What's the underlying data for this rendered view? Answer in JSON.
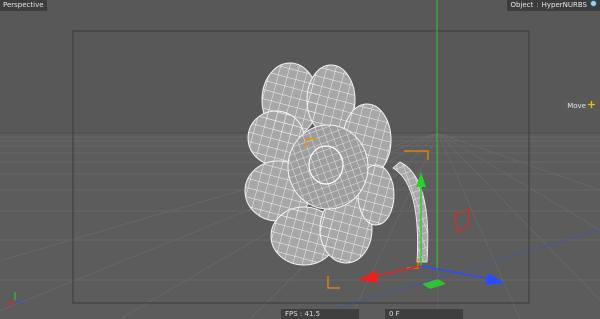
{
  "viewport": {
    "view_name": "Perspective",
    "object_label": "Object",
    "object_separator": ":",
    "object_name": "HyperNURBS",
    "move_label": "Move",
    "fps_label": "FPS",
    "fps_value": "41.5",
    "frame": "0 F",
    "object_icon": "hypernurbs-icon",
    "move_icon": "move-cross-icon",
    "axes_icon": "world-axes-icon"
  },
  "colors": {
    "background": "#5a5a5a",
    "grid": "#6a6a6a",
    "wireframe_fill": "#a9a9a9",
    "wireframe_line": "#f2f2f2",
    "axis_x": "#e8231e",
    "axis_y": "#2bd12b",
    "axis_z": "#2c4bff",
    "selection": "#f08c00"
  }
}
